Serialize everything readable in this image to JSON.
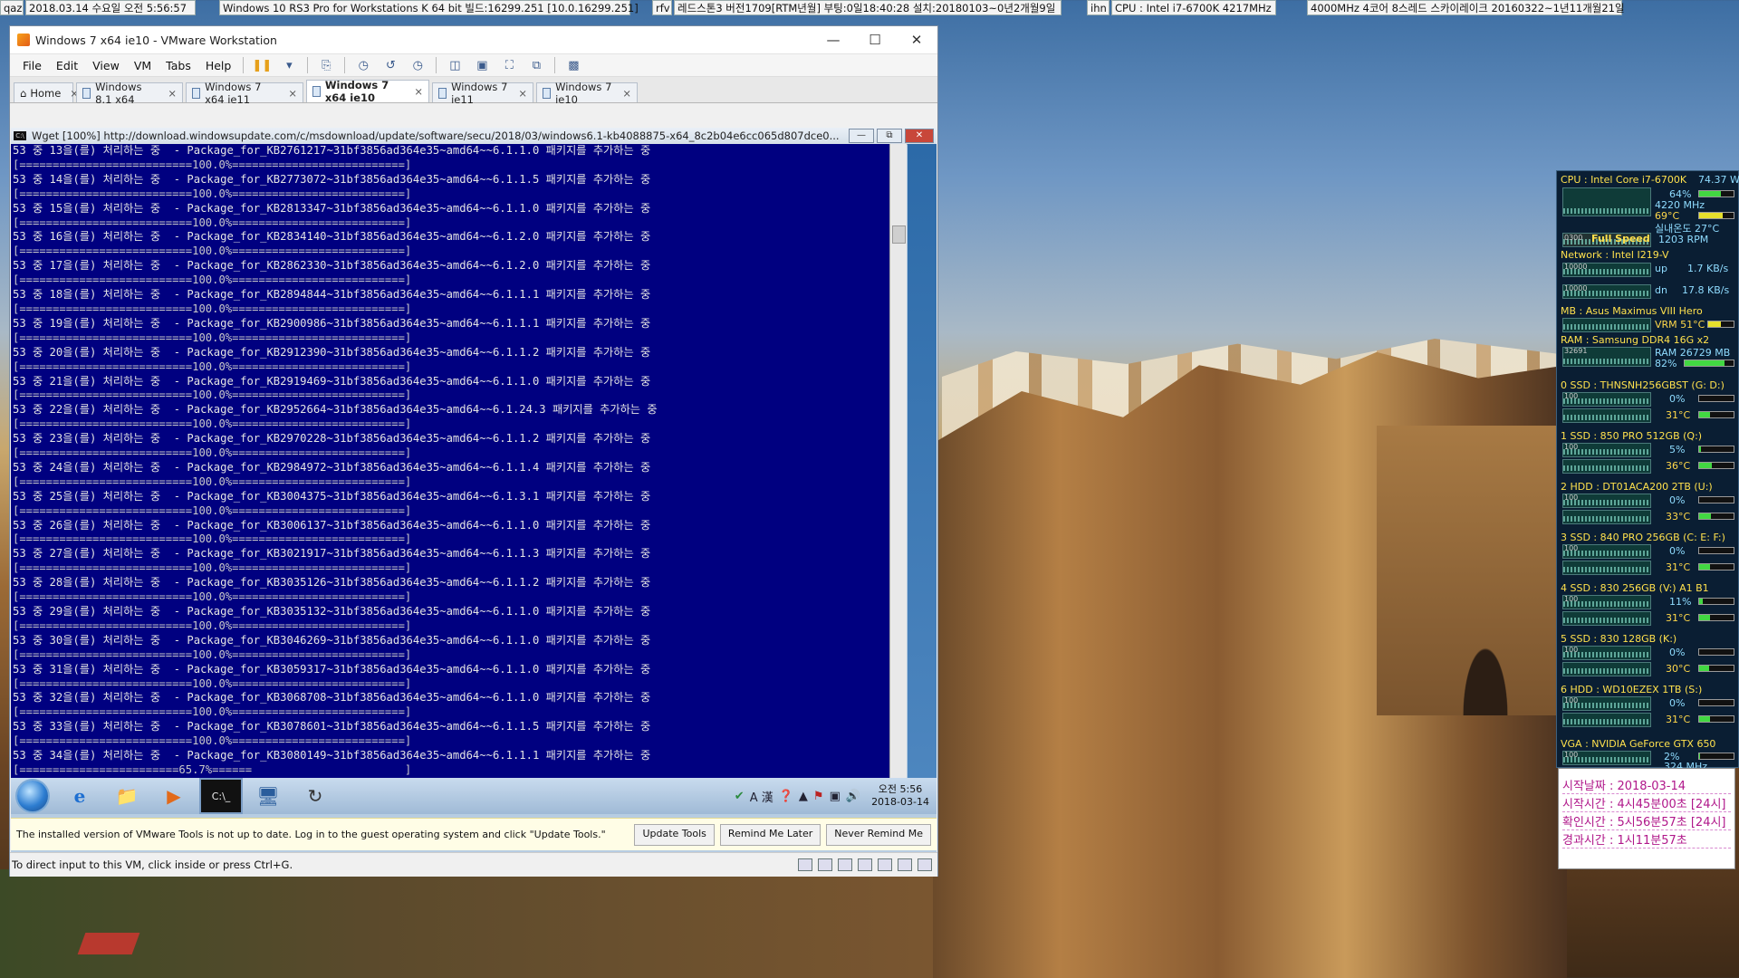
{
  "topbar": {
    "chips": [
      "qaz",
      "2018.03.14 수요일 오전 5:56:57",
      "Windows 10 RS3 Pro for Workstations K 64 bit 빌드:16299.251 [10.0.16299.251]",
      "rfv",
      "레드스톤3 버전1709[RTM년월] 부팅:0일18:40:28 설치:20180103~0년2개월9일",
      "ihn",
      "CPU : Intel i7-6700K 4217MHz",
      "4000MHz 4코어 8스레드 스카이레이크 20160322~1년11개월21일"
    ]
  },
  "vmware": {
    "title": "Windows 7 x64 ie10 - VMware Workstation",
    "menus": [
      "File",
      "Edit",
      "View",
      "VM",
      "Tabs",
      "Help"
    ],
    "tabs": [
      {
        "label": "Home",
        "active": false
      },
      {
        "label": "Windows 8.1 x64",
        "active": false
      },
      {
        "label": "Windows 7 x64 ie11",
        "active": false
      },
      {
        "label": "Windows 7 x64 ie10",
        "active": true
      },
      {
        "label": "Windows 7 ie11",
        "active": false
      },
      {
        "label": "Windows 7 ie10",
        "active": false
      }
    ],
    "cmd_title": "Wget [100%] http://download.windowsupdate.com/c/msdownload/update/software/secu/2018/03/windows6.1-kb4088875-x64_8c2b04e6cc065d807dce0...",
    "console_lines": [
      "53 중 13을(를) 처리하는 중  - Package_for_KB2761217~31bf3856ad364e35~amd64~~6.1.1.0 패키지를 추가하는 중",
      "[==========================100.0%==========================]",
      "53 중 14을(를) 처리하는 중  - Package_for_KB2773072~31bf3856ad364e35~amd64~~6.1.1.5 패키지를 추가하는 중",
      "[==========================100.0%==========================]",
      "53 중 15을(를) 처리하는 중  - Package_for_KB2813347~31bf3856ad364e35~amd64~~6.1.1.0 패키지를 추가하는 중",
      "[==========================100.0%==========================]",
      "53 중 16을(를) 처리하는 중  - Package_for_KB2834140~31bf3856ad364e35~amd64~~6.1.2.0 패키지를 추가하는 중",
      "[==========================100.0%==========================]",
      "53 중 17을(를) 처리하는 중  - Package_for_KB2862330~31bf3856ad364e35~amd64~~6.1.2.0 패키지를 추가하는 중",
      "[==========================100.0%==========================]",
      "53 중 18을(를) 처리하는 중  - Package_for_KB2894844~31bf3856ad364e35~amd64~~6.1.1.1 패키지를 추가하는 중",
      "[==========================100.0%==========================]",
      "53 중 19을(를) 처리하는 중  - Package_for_KB2900986~31bf3856ad364e35~amd64~~6.1.1.1 패키지를 추가하는 중",
      "[==========================100.0%==========================]",
      "53 중 20을(를) 처리하는 중  - Package_for_KB2912390~31bf3856ad364e35~amd64~~6.1.1.2 패키지를 추가하는 중",
      "[==========================100.0%==========================]",
      "53 중 21을(를) 처리하는 중  - Package_for_KB2919469~31bf3856ad364e35~amd64~~6.1.1.0 패키지를 추가하는 중",
      "[==========================100.0%==========================]",
      "53 중 22을(를) 처리하는 중  - Package_for_KB2952664~31bf3856ad364e35~amd64~~6.1.24.3 패키지를 추가하는 중",
      "[==========================100.0%==========================]",
      "53 중 23을(를) 처리하는 중  - Package_for_KB2970228~31bf3856ad364e35~amd64~~6.1.1.2 패키지를 추가하는 중",
      "[==========================100.0%==========================]",
      "53 중 24을(를) 처리하는 중  - Package_for_KB2984972~31bf3856ad364e35~amd64~~6.1.1.4 패키지를 추가하는 중",
      "[==========================100.0%==========================]",
      "53 중 25을(를) 처리하는 중  - Package_for_KB3004375~31bf3856ad364e35~amd64~~6.1.3.1 패키지를 추가하는 중",
      "[==========================100.0%==========================]",
      "53 중 26을(를) 처리하는 중  - Package_for_KB3006137~31bf3856ad364e35~amd64~~6.1.1.0 패키지를 추가하는 중",
      "[==========================100.0%==========================]",
      "53 중 27을(를) 처리하는 중  - Package_for_KB3021917~31bf3856ad364e35~amd64~~6.1.1.3 패키지를 추가하는 중",
      "[==========================100.0%==========================]",
      "53 중 28을(를) 처리하는 중  - Package_for_KB3035126~31bf3856ad364e35~amd64~~6.1.1.2 패키지를 추가하는 중",
      "[==========================100.0%==========================]",
      "53 중 29을(를) 처리하는 중  - Package_for_KB3035132~31bf3856ad364e35~amd64~~6.1.1.0 패키지를 추가하는 중",
      "[==========================100.0%==========================]",
      "53 중 30을(를) 처리하는 중  - Package_for_KB3046269~31bf3856ad364e35~amd64~~6.1.1.0 패키지를 추가하는 중",
      "[==========================100.0%==========================]",
      "53 중 31을(를) 처리하는 중  - Package_for_KB3059317~31bf3856ad364e35~amd64~~6.1.1.0 패키지를 추가하는 중",
      "[==========================100.0%==========================]",
      "53 중 32을(를) 처리하는 중  - Package_for_KB3068708~31bf3856ad364e35~amd64~~6.1.1.0 패키지를 추가하는 중",
      "[==========================100.0%==========================]",
      "53 중 33을(를) 처리하는 중  - Package_for_KB3078601~31bf3856ad364e35~amd64~~6.1.1.5 패키지를 추가하는 중",
      "[==========================100.0%==========================]",
      "53 중 34을(를) 처리하는 중  - Package_for_KB3080149~31bf3856ad364e35~amd64~~6.1.1.1 패키지를 추가하는 중",
      "[========================65.7%======                       ]"
    ],
    "clock_time": "오전 5:56",
    "clock_date": "2018-03-14",
    "tray_text": "A 漢",
    "notify_msg": "The installed version of VMware Tools is not up to date. Log in to the guest operating system and click \"Update Tools.\"",
    "notify_buttons": [
      "Update Tools",
      "Remind Me Later",
      "Never Remind Me"
    ],
    "status_text": "To direct input to this VM, click inside or press Ctrl+G."
  },
  "monitor": {
    "cpu_title": "CPU : Intel Core i7-6700K",
    "cpu_power": "74.37 W",
    "cpu_load": "64%",
    "cpu_clock": "4220 MHz",
    "cpu_temp": "69°C",
    "room_temp": "실내온도 27°C",
    "fan_label": "Full Speed",
    "fan_rpm": "1203 RPM",
    "fan_scale": "0300",
    "net_title": "Network : Intel I219-V",
    "net_scale": "10000",
    "net_up_label": "up",
    "net_up": "1.7 KB/s",
    "net_dn_label": "dn",
    "net_dn": "17.8 KB/s",
    "mb_title": "MB : Asus Maximus VIII Hero",
    "vrm": "VRM 51°C",
    "ram_title": "RAM : Samsung DDR4 16G x2",
    "ram_scale": "32691",
    "ram_used": "RAM 26729 MB",
    "ram_pct": "82%",
    "disks": [
      {
        "title": "0 SSD : THNSNH256GBST (G: D:)",
        "load": "0%",
        "temp": "31°C",
        "scale": "100"
      },
      {
        "title": "1 SSD : 850 PRO 512GB (Q:)",
        "load": "5%",
        "temp": "36°C",
        "scale": "100"
      },
      {
        "title": "2 HDD : DT01ACA200 2TB (U:)",
        "load": "0%",
        "temp": "33°C",
        "scale": "100"
      },
      {
        "title": "3 SSD : 840 PRO 256GB (C: E: F:)",
        "load": "0%",
        "temp": "31°C",
        "scale": "100"
      },
      {
        "title": "4 SSD : 830 256GB (V:) A1 B1",
        "load": "11%",
        "temp": "31°C",
        "scale": "100"
      },
      {
        "title": "5 SSD : 830 128GB (K:)",
        "load": "0%",
        "temp": "30°C",
        "scale": "100"
      },
      {
        "title": "6 HDD : WD10EZEX 1TB (S:)",
        "load": "0%",
        "temp": "31°C",
        "scale": "100"
      }
    ],
    "vga_title": "VGA : NVIDIA GeForce GTX 650",
    "vga_load": "2%",
    "vga_clock": "324 MHz",
    "vga_scale": "100"
  },
  "log": {
    "start_date": "시작날짜 : 2018-03-14",
    "start_time": "시작시간 : 4시45분00초 [24시]",
    "check_time": "확인시간 : 5시56분57초 [24시]",
    "elapsed": "경과시간 : 1시11분57초"
  }
}
